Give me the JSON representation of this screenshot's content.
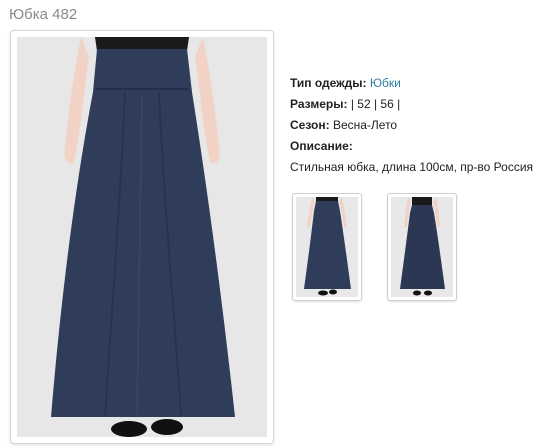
{
  "page": {
    "title": "Юбка 482"
  },
  "product": {
    "type_label": "Тип одежды:",
    "type_value": "Юбки",
    "sizes_label": "Размеры:",
    "sizes_value": "| 52 | 56 |",
    "season_label": "Сезон:",
    "season_value": "Весна-Лето",
    "description_label": "Описание:",
    "description_value": "Стильная юбка, длина 100см, пр-во Россия"
  },
  "colors": {
    "skirt": "#2f3d5a",
    "background": "#e7e7e7",
    "link": "#2f7fa0",
    "title": "#8a8a8a"
  },
  "images": {
    "main": "skirt-front-photo",
    "thumbnails": [
      "skirt-front-thumbnail",
      "skirt-back-thumbnail"
    ]
  }
}
